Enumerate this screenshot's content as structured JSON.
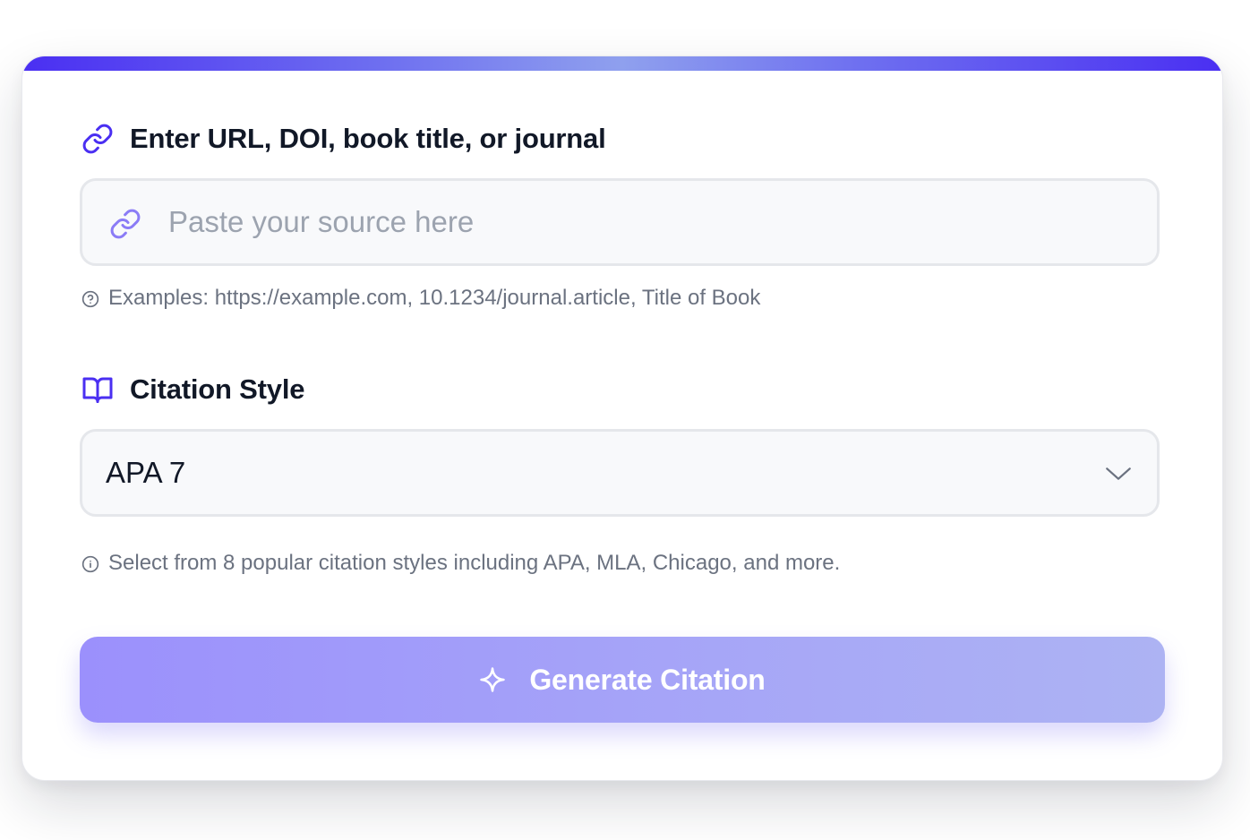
{
  "source_field": {
    "label": "Enter URL, DOI, book title, or journal",
    "label_icon": "link-icon",
    "input_icon": "link-icon",
    "placeholder": "Paste your source here",
    "value": "",
    "hint_icon": "help-circle-icon",
    "hint": "Examples: https://example.com, 10.1234/journal.article, Title of Book"
  },
  "style_field": {
    "label": "Citation Style",
    "label_icon": "book-open-icon",
    "selected": "APA 7",
    "dropdown_icon": "chevron-down-icon",
    "hint_icon": "info-circle-icon",
    "hint": "Select from 8 popular citation styles including APA, MLA, Chicago, and more."
  },
  "generate_button": {
    "label": "Generate Citation",
    "icon": "sparkle-icon"
  },
  "colors": {
    "accent": "#4a2ff2",
    "heading_text": "#111827",
    "muted_text": "#6b7280",
    "button_start": "#9b90fc",
    "button_end": "#adb3f3"
  }
}
